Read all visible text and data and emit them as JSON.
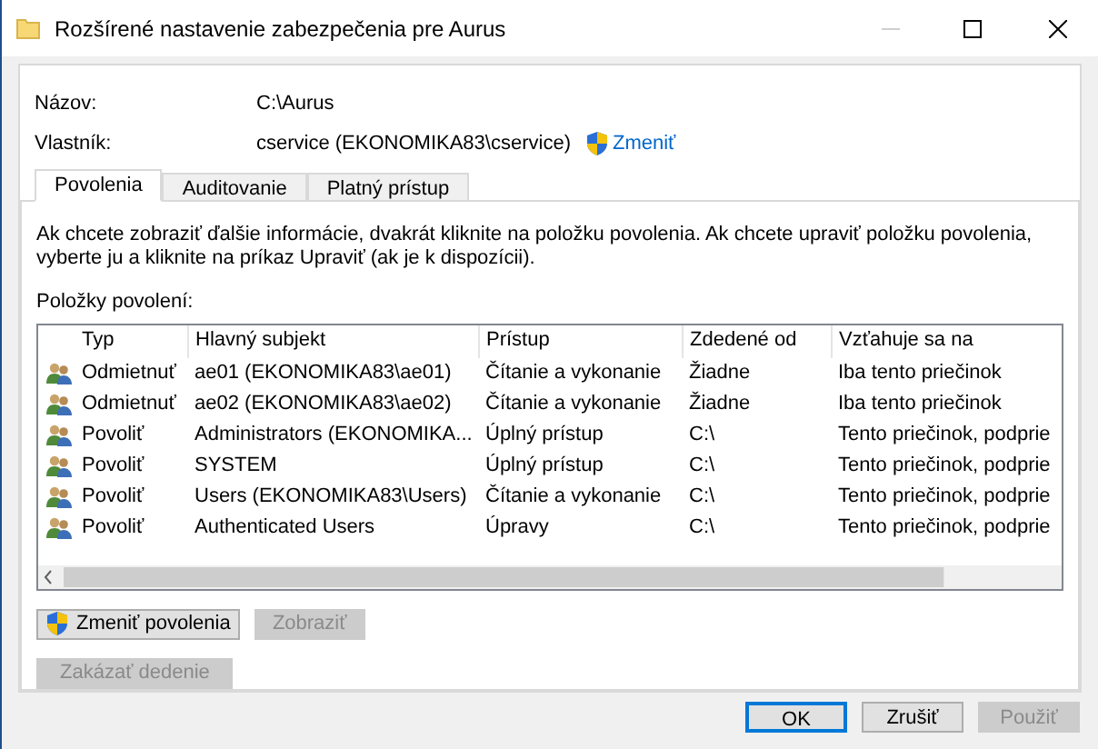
{
  "window": {
    "title": "Rozšírené nastavenie zabezpečenia pre Aurus"
  },
  "fields": [
    {
      "label": "Názov:",
      "value": "C:\\Aurus"
    },
    {
      "label": "Vlastník:",
      "value": "cservice (EKONOMIKA83\\cservice)",
      "link": "Zmeniť"
    }
  ],
  "tabs": [
    {
      "label": "Povolenia",
      "selected": true
    },
    {
      "label": "Auditovanie",
      "selected": false
    },
    {
      "label": "Platný prístup",
      "selected": false
    }
  ],
  "info": "Ak chcete zobraziť ďalšie informácie, dvakrát kliknite na položku povolenia. Ak chcete upraviť položku povolenia, vyberte ju a kliknite na príkaz Upraviť (ak je k dispozícii).",
  "list_label": "Položky povolení:",
  "table": {
    "columns": [
      "Typ",
      "Hlavný subjekt",
      "Prístup",
      "Zdedené od",
      "Vzťahuje sa na"
    ],
    "rows": [
      [
        "Odmietnuť",
        "ae01 (EKONOMIKA83\\ae01)",
        "Čítanie a vykonanie",
        "Žiadne",
        "Iba tento priečinok"
      ],
      [
        "Odmietnuť",
        "ae02 (EKONOMIKA83\\ae02)",
        "Čítanie a vykonanie",
        "Žiadne",
        "Iba tento priečinok"
      ],
      [
        "Povoliť",
        "Administrators (EKONOMIKA...",
        "Úplný prístup",
        "C:\\",
        "Tento priečinok, podprie"
      ],
      [
        "Povoliť",
        "SYSTEM",
        "Úplný prístup",
        "C:\\",
        "Tento priečinok, podprie"
      ],
      [
        "Povoliť",
        "Users (EKONOMIKA83\\Users)",
        "Čítanie a vykonanie",
        "C:\\",
        "Tento priečinok, podprie"
      ],
      [
        "Povoliť",
        "Authenticated Users",
        "Úpravy",
        "C:\\",
        "Tento priečinok, podprie"
      ]
    ]
  },
  "panel_buttons": [
    {
      "label": "Zmeniť povolenia",
      "disabled": false,
      "shield": true
    },
    {
      "label": "Zobraziť",
      "disabled": true,
      "shield": false
    },
    {
      "label": "Zakázať dedenie",
      "disabled": true,
      "shield": false
    }
  ],
  "dialog_buttons": [
    {
      "label": "OK",
      "disabled": false,
      "default": true
    },
    {
      "label": "Zrušiť",
      "disabled": false,
      "default": false
    },
    {
      "label": "Použiť",
      "disabled": true,
      "default": false
    }
  ]
}
